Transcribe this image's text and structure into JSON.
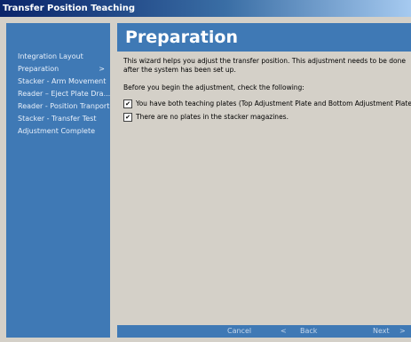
{
  "window": {
    "title": "Transfer Position Teaching"
  },
  "sidebar": {
    "items": [
      {
        "label": "Integration Layout"
      },
      {
        "label": "Preparation",
        "active_marker": ">"
      },
      {
        "label": "Stacker - Arm Movement"
      },
      {
        "label": "Reader – Eject Plate Dra..."
      },
      {
        "label": "Reader - Position Tranport"
      },
      {
        "label": "Stacker - Transfer Test"
      },
      {
        "label": "Adjustment Complete"
      }
    ]
  },
  "content": {
    "title": "Preparation",
    "intro": "This wizard helps you adjust the transfer position. This adjustment needs to be done after the system has been set up.",
    "checklist_lead": "Before you begin the adjustment, check the following:",
    "checklist": [
      {
        "checked": true,
        "text": "You have both teaching plates (Top Adjustment Plate and Bottom Adjustment Plate)."
      },
      {
        "checked": true,
        "text": "There are no plates in the stacker magazines."
      }
    ]
  },
  "footer": {
    "cancel_label": "Cancel",
    "back_label": "Back",
    "back_icon": "<",
    "next_label": "Next",
    "next_icon": ">"
  },
  "colors": {
    "accent": "#3f79b5",
    "title_gradient_start": "#0a246a",
    "background": "#d4d0c8"
  }
}
